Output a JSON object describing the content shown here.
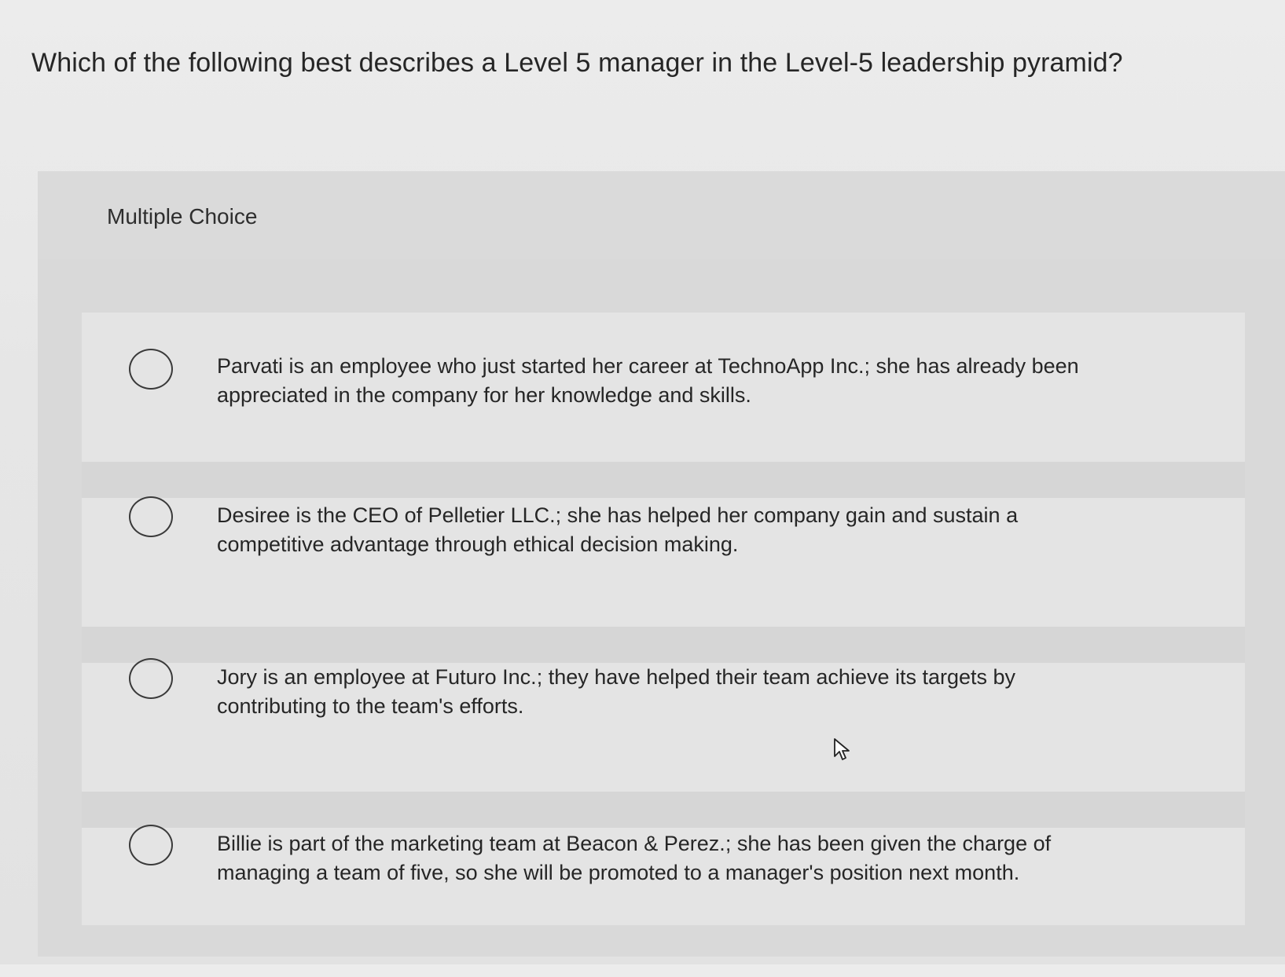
{
  "question": "Which of the following best describes a Level 5 manager in the Level-5 leadership pyramid?",
  "section_label": "Multiple Choice",
  "options": [
    {
      "text": "Parvati is an employee who just started her career at TechnoApp Inc.; she has already been appreciated in the company for her knowledge and skills.",
      "selected": false
    },
    {
      "text": "Desiree is the CEO of Pelletier LLC.; she has helped her company gain and sustain a competitive advantage through ethical decision making.",
      "selected": false
    },
    {
      "text": "Jory is an employee at Futuro Inc.; they have helped their team achieve its targets by contributing to the team's efforts.",
      "selected": false
    },
    {
      "text": "Billie is part of the marketing team at Beacon & Perez.; she has been given the charge of managing a team of five, so she will be promoted to a manager's position next month.",
      "selected": false
    }
  ],
  "cursor_icon": "mouse-pointer-icon"
}
